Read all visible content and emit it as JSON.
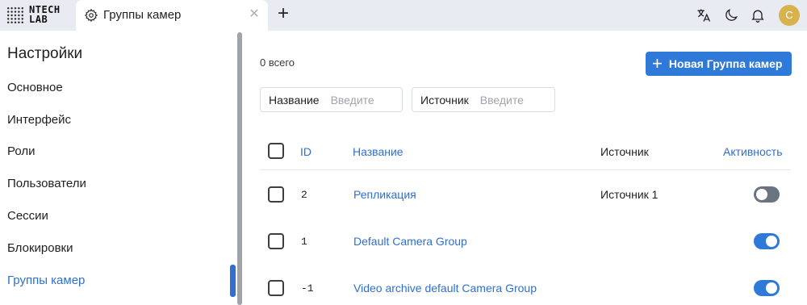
{
  "logo": {
    "line1": "NTECH",
    "line2": "LAB"
  },
  "tab": {
    "label": "Группы камер",
    "icon": "gear-icon",
    "close": "✕",
    "add": "+"
  },
  "topbar": {
    "icons": [
      "translate-icon",
      "moon-icon",
      "bell-icon"
    ],
    "avatar": "C"
  },
  "sidebar": {
    "title": "Настройки",
    "items": [
      {
        "label": "Основное"
      },
      {
        "label": "Интерфейс"
      },
      {
        "label": "Роли"
      },
      {
        "label": "Пользователи"
      },
      {
        "label": "Сессии"
      },
      {
        "label": "Блокировки"
      },
      {
        "label": "Группы камер",
        "active": true
      }
    ]
  },
  "main": {
    "count": "0 всего",
    "new_button": "Новая Группа камер",
    "filters": [
      {
        "label": "Название",
        "placeholder": "Введите"
      },
      {
        "label": "Источник",
        "placeholder": "Введите"
      }
    ],
    "columns": {
      "id": "ID",
      "name": "Название",
      "source": "Источник",
      "active": "Активность"
    },
    "rows": [
      {
        "id": "2",
        "name": "Репликация",
        "source": "Источник 1",
        "active": false
      },
      {
        "id": "1",
        "name": "Default Camera Group",
        "source": "",
        "active": true
      },
      {
        "id": "-1",
        "name": "Video archive default Camera Group",
        "source": "",
        "active": true
      }
    ]
  },
  "colors": {
    "accent": "#2f7ad9",
    "link": "#2f6fd0",
    "topbar": "#e8ecf2",
    "avatar": "#d7b24d"
  }
}
